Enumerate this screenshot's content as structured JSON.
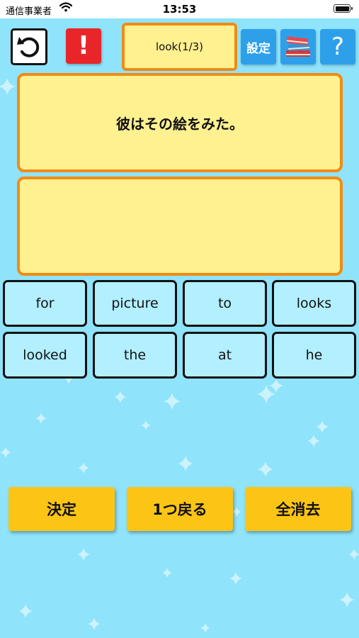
{
  "status_bar": {
    "carrier": "通信事業者",
    "time": "13:53"
  },
  "toolbar": {
    "alert_label": "!",
    "word_progress": "look(1/3)",
    "settings_label": "設定",
    "help_label": "?"
  },
  "question": {
    "japanese": "彼はその絵をみた。"
  },
  "answer": {
    "text": ""
  },
  "word_tiles": [
    "for",
    "picture",
    "to",
    "looks",
    "looked",
    "the",
    "at",
    "he"
  ],
  "actions": {
    "confirm": "決定",
    "back_one": "1つ戻る",
    "clear_all": "全消去"
  },
  "colors": {
    "background": "#8fe3fb",
    "accent_orange": "#f08c14",
    "card_yellow": "#fff090",
    "tile_blue": "#b2efff",
    "button_yellow": "#fcc516",
    "alert_red": "#e8262a",
    "toolbar_blue": "#2ea0ea"
  }
}
